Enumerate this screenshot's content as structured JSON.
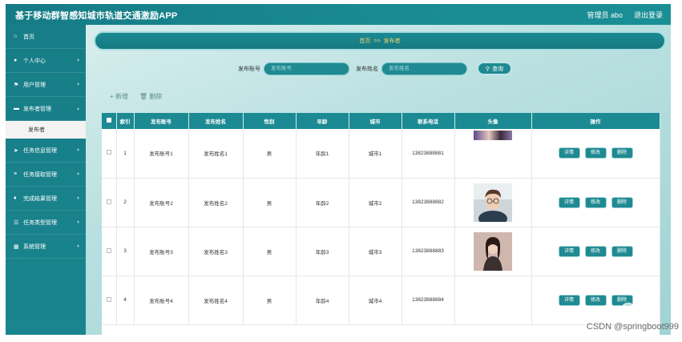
{
  "header": {
    "app_title": "基于移动群智感知城市轨道交通激励APP",
    "user_label": "管理员 abo",
    "logout_label": "退出登录"
  },
  "sidebar": {
    "items": [
      {
        "label": "首页",
        "icon": "home-icon"
      },
      {
        "label": "个人中心",
        "icon": "user-icon"
      },
      {
        "label": "用户管理",
        "icon": "flag-icon"
      },
      {
        "label": "发布者管理",
        "icon": "monitor-icon"
      },
      {
        "label": "任务信息管理",
        "icon": "send-icon"
      },
      {
        "label": "任务接取管理",
        "icon": "stack-icon"
      },
      {
        "label": "完成结果管理",
        "icon": "pin-icon"
      },
      {
        "label": "任务类型管理",
        "icon": "sliders-icon"
      },
      {
        "label": "系统管理",
        "icon": "grid-icon"
      }
    ],
    "active_submenu": "发布者"
  },
  "breadcrumb": {
    "home": "首页",
    "separator": ">>",
    "current": "发布者"
  },
  "search": {
    "account_label": "发布账号",
    "account_placeholder": "发布账号",
    "name_label": "发布姓名",
    "name_placeholder": "发布姓名",
    "button_label": "查询"
  },
  "toolbar": {
    "add_label": "+ 新增",
    "delete_label": "删除"
  },
  "table": {
    "columns": [
      "索引",
      "发布账号",
      "发布姓名",
      "性别",
      "年龄",
      "城市",
      "联系电话",
      "头像",
      "操作"
    ],
    "rows": [
      {
        "index": "1",
        "account": "发布账号1",
        "name": "发布姓名1",
        "gender": "男",
        "age": "年龄1",
        "city": "城市1",
        "phone": "13823888881",
        "avatar": "partial"
      },
      {
        "index": "2",
        "account": "发布账号2",
        "name": "发布姓名2",
        "gender": "男",
        "age": "年龄2",
        "city": "城市2",
        "phone": "13823888882",
        "avatar": "glasses"
      },
      {
        "index": "3",
        "account": "发布账号3",
        "name": "发布姓名3",
        "gender": "男",
        "age": "年龄3",
        "city": "城市3",
        "phone": "13823888883",
        "avatar": "girl"
      },
      {
        "index": "4",
        "account": "发布账号4",
        "name": "发布姓名4",
        "gender": "男",
        "age": "年龄4",
        "city": "城市4",
        "phone": "13823888884",
        "avatar": "none"
      }
    ],
    "op_buttons": [
      "详情",
      "修改",
      "删除"
    ]
  },
  "watermark": {
    "csdn": "CSDN @springboot999"
  },
  "colors": {
    "primary": "#1b8a93",
    "breadcrumb_text": "#f2d36b"
  }
}
